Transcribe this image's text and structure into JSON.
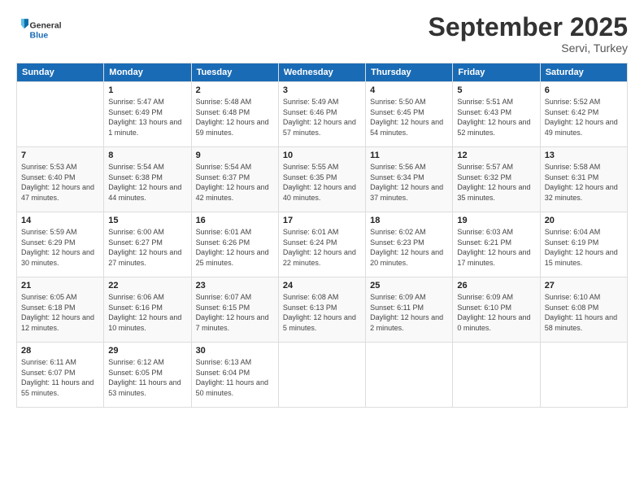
{
  "logo": {
    "line1": "General",
    "line2": "Blue"
  },
  "title": "September 2025",
  "location": "Servi, Turkey",
  "weekdays": [
    "Sunday",
    "Monday",
    "Tuesday",
    "Wednesday",
    "Thursday",
    "Friday",
    "Saturday"
  ],
  "weeks": [
    [
      {
        "day": "",
        "info": ""
      },
      {
        "day": "1",
        "info": "Sunrise: 5:47 AM\nSunset: 6:49 PM\nDaylight: 13 hours\nand 1 minute."
      },
      {
        "day": "2",
        "info": "Sunrise: 5:48 AM\nSunset: 6:48 PM\nDaylight: 12 hours\nand 59 minutes."
      },
      {
        "day": "3",
        "info": "Sunrise: 5:49 AM\nSunset: 6:46 PM\nDaylight: 12 hours\nand 57 minutes."
      },
      {
        "day": "4",
        "info": "Sunrise: 5:50 AM\nSunset: 6:45 PM\nDaylight: 12 hours\nand 54 minutes."
      },
      {
        "day": "5",
        "info": "Sunrise: 5:51 AM\nSunset: 6:43 PM\nDaylight: 12 hours\nand 52 minutes."
      },
      {
        "day": "6",
        "info": "Sunrise: 5:52 AM\nSunset: 6:42 PM\nDaylight: 12 hours\nand 49 minutes."
      }
    ],
    [
      {
        "day": "7",
        "info": "Sunrise: 5:53 AM\nSunset: 6:40 PM\nDaylight: 12 hours\nand 47 minutes."
      },
      {
        "day": "8",
        "info": "Sunrise: 5:54 AM\nSunset: 6:38 PM\nDaylight: 12 hours\nand 44 minutes."
      },
      {
        "day": "9",
        "info": "Sunrise: 5:54 AM\nSunset: 6:37 PM\nDaylight: 12 hours\nand 42 minutes."
      },
      {
        "day": "10",
        "info": "Sunrise: 5:55 AM\nSunset: 6:35 PM\nDaylight: 12 hours\nand 40 minutes."
      },
      {
        "day": "11",
        "info": "Sunrise: 5:56 AM\nSunset: 6:34 PM\nDaylight: 12 hours\nand 37 minutes."
      },
      {
        "day": "12",
        "info": "Sunrise: 5:57 AM\nSunset: 6:32 PM\nDaylight: 12 hours\nand 35 minutes."
      },
      {
        "day": "13",
        "info": "Sunrise: 5:58 AM\nSunset: 6:31 PM\nDaylight: 12 hours\nand 32 minutes."
      }
    ],
    [
      {
        "day": "14",
        "info": "Sunrise: 5:59 AM\nSunset: 6:29 PM\nDaylight: 12 hours\nand 30 minutes."
      },
      {
        "day": "15",
        "info": "Sunrise: 6:00 AM\nSunset: 6:27 PM\nDaylight: 12 hours\nand 27 minutes."
      },
      {
        "day": "16",
        "info": "Sunrise: 6:01 AM\nSunset: 6:26 PM\nDaylight: 12 hours\nand 25 minutes."
      },
      {
        "day": "17",
        "info": "Sunrise: 6:01 AM\nSunset: 6:24 PM\nDaylight: 12 hours\nand 22 minutes."
      },
      {
        "day": "18",
        "info": "Sunrise: 6:02 AM\nSunset: 6:23 PM\nDaylight: 12 hours\nand 20 minutes."
      },
      {
        "day": "19",
        "info": "Sunrise: 6:03 AM\nSunset: 6:21 PM\nDaylight: 12 hours\nand 17 minutes."
      },
      {
        "day": "20",
        "info": "Sunrise: 6:04 AM\nSunset: 6:19 PM\nDaylight: 12 hours\nand 15 minutes."
      }
    ],
    [
      {
        "day": "21",
        "info": "Sunrise: 6:05 AM\nSunset: 6:18 PM\nDaylight: 12 hours\nand 12 minutes."
      },
      {
        "day": "22",
        "info": "Sunrise: 6:06 AM\nSunset: 6:16 PM\nDaylight: 12 hours\nand 10 minutes."
      },
      {
        "day": "23",
        "info": "Sunrise: 6:07 AM\nSunset: 6:15 PM\nDaylight: 12 hours\nand 7 minutes."
      },
      {
        "day": "24",
        "info": "Sunrise: 6:08 AM\nSunset: 6:13 PM\nDaylight: 12 hours\nand 5 minutes."
      },
      {
        "day": "25",
        "info": "Sunrise: 6:09 AM\nSunset: 6:11 PM\nDaylight: 12 hours\nand 2 minutes."
      },
      {
        "day": "26",
        "info": "Sunrise: 6:09 AM\nSunset: 6:10 PM\nDaylight: 12 hours\nand 0 minutes."
      },
      {
        "day": "27",
        "info": "Sunrise: 6:10 AM\nSunset: 6:08 PM\nDaylight: 11 hours\nand 58 minutes."
      }
    ],
    [
      {
        "day": "28",
        "info": "Sunrise: 6:11 AM\nSunset: 6:07 PM\nDaylight: 11 hours\nand 55 minutes."
      },
      {
        "day": "29",
        "info": "Sunrise: 6:12 AM\nSunset: 6:05 PM\nDaylight: 11 hours\nand 53 minutes."
      },
      {
        "day": "30",
        "info": "Sunrise: 6:13 AM\nSunset: 6:04 PM\nDaylight: 11 hours\nand 50 minutes."
      },
      {
        "day": "",
        "info": ""
      },
      {
        "day": "",
        "info": ""
      },
      {
        "day": "",
        "info": ""
      },
      {
        "day": "",
        "info": ""
      }
    ]
  ]
}
